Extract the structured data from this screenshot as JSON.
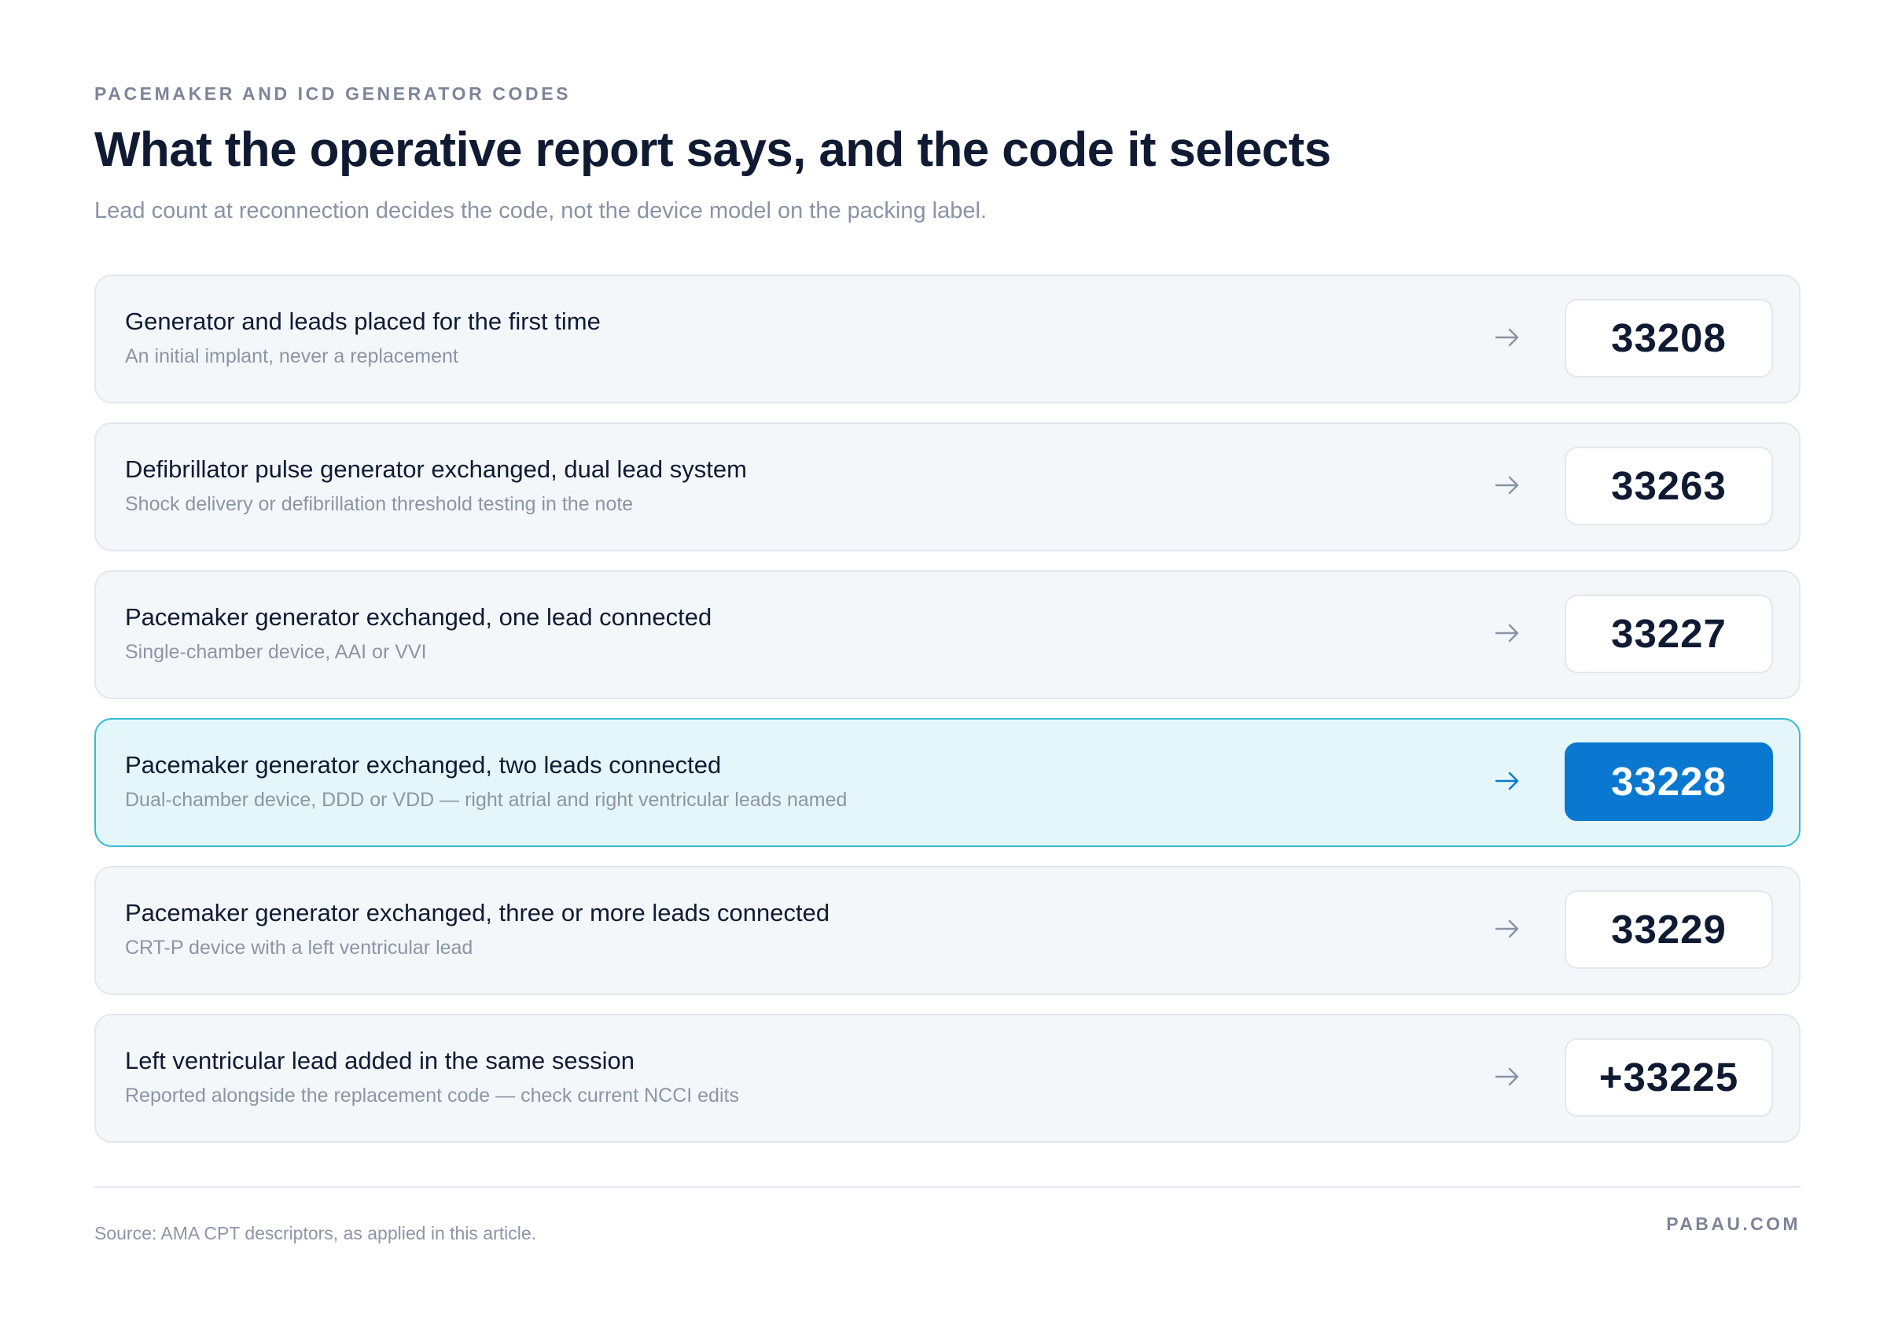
{
  "header": {
    "eyebrow": "PACEMAKER AND ICD GENERATOR CODES",
    "title": "What the operative report says, and the code it selects",
    "subtitle": "Lead count at reconnection decides the code, not the device model on the packing label."
  },
  "rows": [
    {
      "title": "Generator and leads placed for the first time",
      "subtitle": "An initial implant, never a replacement",
      "code": "33208",
      "highlighted": false
    },
    {
      "title": "Defibrillator pulse generator exchanged, dual lead system",
      "subtitle": "Shock delivery or defibrillation threshold testing in the note",
      "code": "33263",
      "highlighted": false
    },
    {
      "title": "Pacemaker generator exchanged, one lead connected",
      "subtitle": "Single-chamber device, AAI or VVI",
      "code": "33227",
      "highlighted": false
    },
    {
      "title": "Pacemaker generator exchanged, two leads connected",
      "subtitle": "Dual-chamber device, DDD or VDD — right atrial and right ventricular leads named",
      "code": "33228",
      "highlighted": true
    },
    {
      "title": "Pacemaker generator exchanged, three or more leads connected",
      "subtitle": "CRT-P device with a left ventricular lead",
      "code": "33229",
      "highlighted": false
    },
    {
      "title": "Left ventricular lead added in the same session",
      "subtitle": "Reported alongside the replacement code — check current NCCI edits",
      "code": "+33225",
      "highlighted": false
    }
  ],
  "footer": {
    "source": "Source: AMA CPT descriptors, as applied in this article.",
    "brand": "PABAU.COM"
  },
  "colors": {
    "highlight_accent": "#0a78d0",
    "highlight_border": "#35bcd4",
    "highlight_background": "#e4f6fa",
    "arrow_default": "#8a93a4",
    "arrow_highlight": "#0a78d0"
  },
  "icons": {
    "row_arrow": "arrow-right-icon"
  }
}
